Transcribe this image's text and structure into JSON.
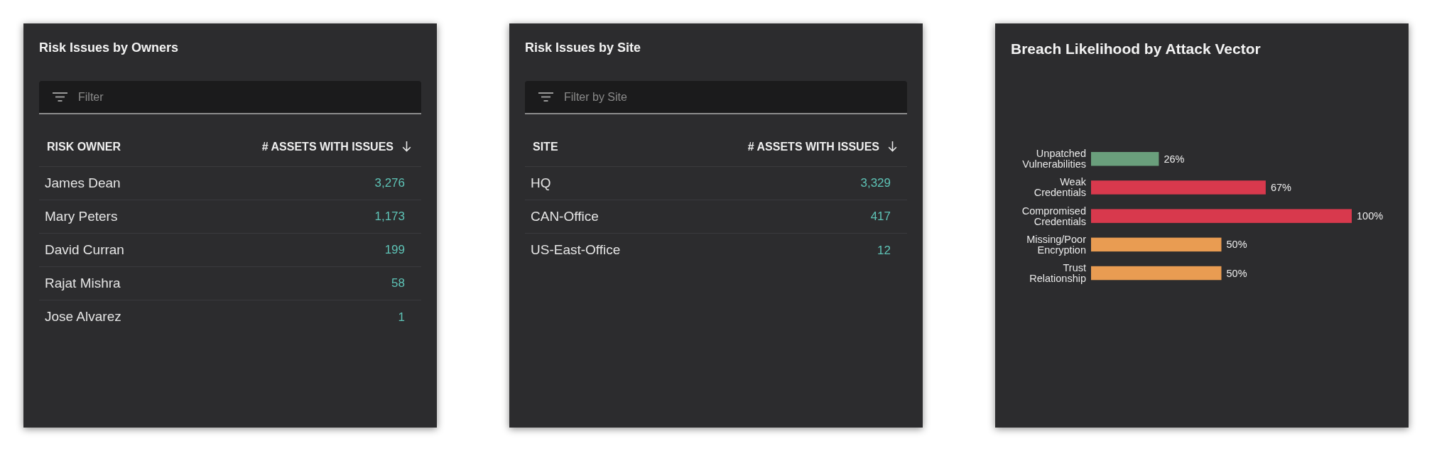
{
  "panels": [
    {
      "kind": "table",
      "title": "Risk Issues by Owners",
      "filter": {
        "placeholder": "Filter"
      },
      "columns": [
        {
          "label": "RISK OWNER",
          "sorted": false
        },
        {
          "label": "# ASSETS WITH ISSUES",
          "sorted": true
        }
      ],
      "rows": [
        [
          "James Dean",
          "3,276"
        ],
        [
          "Mary Peters",
          "1,173"
        ],
        [
          "David Curran",
          "199"
        ],
        [
          "Rajat Mishra",
          "58"
        ],
        [
          "Jose Alvarez",
          "1"
        ]
      ]
    },
    {
      "kind": "table",
      "title": "Risk Issues by Site",
      "filter": {
        "placeholder": "Filter by Site"
      },
      "columns": [
        {
          "label": "SITE",
          "sorted": false
        },
        {
          "label": "# ASSETS WITH ISSUES",
          "sorted": true
        }
      ],
      "rows": [
        [
          "HQ",
          "3,329"
        ],
        [
          "CAN-Office",
          "417"
        ],
        [
          "US-East-Office",
          "12"
        ]
      ]
    },
    {
      "kind": "chart",
      "chart_data": {
        "type": "bar",
        "title": "Breach Likelihood by Attack Vector",
        "orientation": "horizontal",
        "categories": [
          "Unpatched Vulnerabilities",
          "Weak Credentials",
          "Compromised Credentials",
          "Missing/Poor Encryption",
          "Trust Relationship"
        ],
        "values": [
          26,
          67,
          100,
          50,
          50
        ],
        "colors": [
          "#6a9f7c",
          "#d8394d",
          "#d8394d",
          "#e99c52",
          "#e99c52"
        ],
        "value_labels": [
          "26%",
          "67%",
          "100%",
          "50%",
          "50%"
        ],
        "xlim": [
          0,
          100
        ]
      }
    }
  ]
}
